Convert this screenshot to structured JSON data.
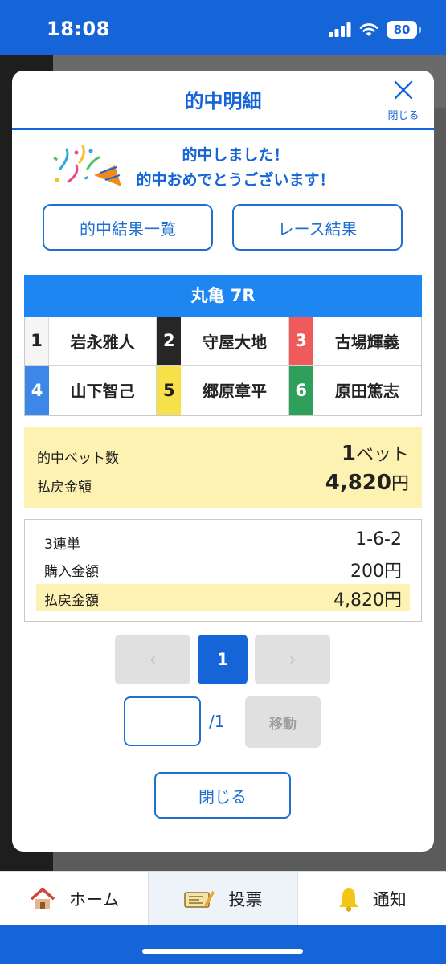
{
  "status_bar": {
    "time": "18:08",
    "battery": "80"
  },
  "modal": {
    "title": "的中明細",
    "close_icon_label": "閉じる",
    "message_line1": "的中しました！",
    "message_line2": "的中おめでとうございます！",
    "btn_results_list": "的中結果一覧",
    "btn_race_results": "レース結果"
  },
  "race": {
    "title": "丸亀 7R",
    "racers": [
      {
        "lane": "1",
        "name": "岩永雅人"
      },
      {
        "lane": "2",
        "name": "守屋大地"
      },
      {
        "lane": "3",
        "name": "古場輝義"
      },
      {
        "lane": "4",
        "name": "山下智己"
      },
      {
        "lane": "5",
        "name": "郷原章平"
      },
      {
        "lane": "6",
        "name": "原田篤志"
      }
    ]
  },
  "summary": {
    "hit_bets_label": "的中ベット数",
    "hit_bets_count": "1",
    "hit_bets_unit": "ベット",
    "payout_label": "払戻金額",
    "payout_value": "4,820",
    "payout_unit": "円"
  },
  "detail": {
    "bet_type": "3連単",
    "combination": "1-6-2",
    "purchase_label": "購入金額",
    "purchase_value": "200円",
    "payout_label": "払戻金額",
    "payout_value": "4,820円"
  },
  "pagination": {
    "prev": "‹",
    "current": "1",
    "next": "›",
    "input_value": "",
    "total": "/1",
    "move_label": "移動"
  },
  "close_button": "閉じる",
  "tabbar": {
    "home": "ホーム",
    "vote": "投票",
    "notify": "通知"
  },
  "colors": {
    "primary": "#1565d8",
    "header_bar": "#1e86f0",
    "highlight": "#fdf2b1"
  }
}
